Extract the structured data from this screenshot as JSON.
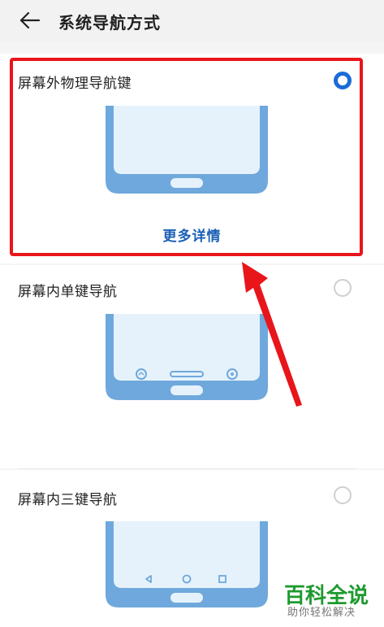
{
  "header": {
    "title": "系统导航方式",
    "back_icon": "arrow-left-icon"
  },
  "options": [
    {
      "label": "屏幕外物理导航键",
      "selected": true,
      "more_link": "更多详情"
    },
    {
      "label": "屏幕内单键导航",
      "selected": false
    },
    {
      "label": "屏幕内三键导航",
      "selected": false
    }
  ],
  "colors": {
    "accent": "#1a6bd8",
    "highlight": "#e8151b",
    "phone_frame": "#6fa8dc",
    "phone_screen": "#e6f2fb",
    "watermark": "#1e9a2f"
  },
  "watermark": {
    "title": "百科全说",
    "subtitle": "助你轻松解决"
  }
}
